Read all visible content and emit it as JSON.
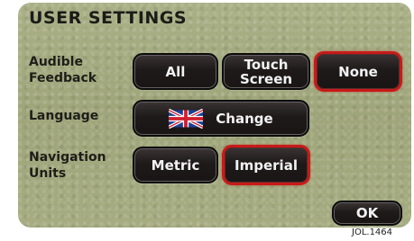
{
  "screen": {
    "title": "USER SETTINGS"
  },
  "settings": {
    "audible_feedback": {
      "label": "Audible\nFeedback",
      "options": [
        "All",
        "Touch\nScreen",
        "None"
      ],
      "selected": "None"
    },
    "language": {
      "label": "Language",
      "button_label": "Change",
      "flag_icon": "uk-flag-icon"
    },
    "navigation_units": {
      "label": "Navigation\nUnits",
      "options": [
        "Metric",
        "Imperial"
      ],
      "selected": "Imperial"
    }
  },
  "footer": {
    "ok_label": "OK"
  },
  "caption": "JOL.1464",
  "colors": {
    "selected_border": "#c71a1a",
    "button_fill": "#1f1a1a",
    "background": "#a3a87e"
  }
}
